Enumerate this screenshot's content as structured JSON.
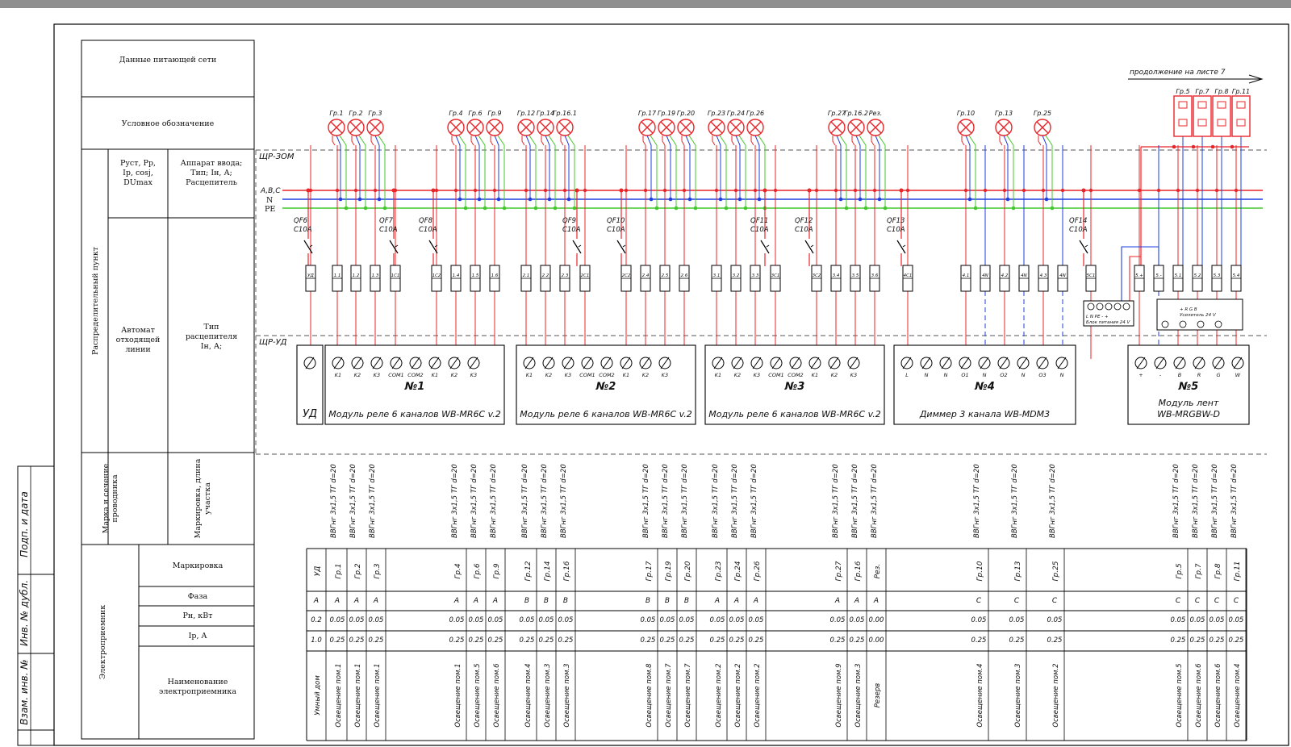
{
  "continuation": "продолжение на листе 7",
  "panels": {
    "main": "ЩР-ЗОМ",
    "ud": "ЩР-УД"
  },
  "bus": {
    "phase": "A,B,C",
    "neutral": "N",
    "pe": "PE"
  },
  "colors": {
    "phase": "#e8262a",
    "neutral": "#1f3fe0",
    "pe": "#42c82a",
    "lamp": "#e8262a",
    "frame": "#000000"
  },
  "header": {
    "network": "Данные питающей сети",
    "symbol": "Условное обозначение",
    "dist_point": "Распределительный пункт",
    "params": [
      "Руст, Рр,",
      "Ip, cosj,",
      "DUmax"
    ],
    "input_device": [
      "Аппарат ввода;",
      "Тип; Iн, А;",
      "Расцепитель"
    ],
    "outgoing": [
      "Автомат",
      "отходящей",
      "линии"
    ],
    "release": [
      "Тип",
      "расцепителя",
      "Iн, А;"
    ],
    "wire": [
      "Марка и сечение",
      "проводника"
    ],
    "wire_mark": [
      "Маркировка, длина",
      "участка"
    ],
    "consumer": "Электроприемник",
    "marking": "Маркировка",
    "phase": "Фаза",
    "power": "Рн, кВт",
    "current": "Ip, A",
    "name": [
      "Наименование",
      "электроприемника"
    ]
  },
  "stamps": [
    "Подп. и дата",
    "Инв. № дубл.",
    "Взам. инв. №"
  ],
  "lamp_groups": [
    {
      "labels": [
        "Гр.1",
        "Гр.2",
        "Гр.3"
      ]
    },
    {
      "labels": [
        "Гр.4",
        "Гр.6",
        "Гр.9"
      ]
    },
    {
      "labels": [
        "Гр.12",
        "Гр.14",
        "Гр.16.1"
      ]
    },
    {
      "labels": [
        "Гр.17",
        "Гр.19",
        "Гр.20"
      ]
    },
    {
      "labels": [
        "Гр.23",
        "Гр.24",
        "Гр.26"
      ]
    },
    {
      "labels": [
        "Гр.27",
        "Гр.16.2",
        "Рез."
      ]
    },
    {
      "labels": [
        "Гр.10"
      ]
    },
    {
      "labels": [
        "Гр.13"
      ]
    },
    {
      "labels": [
        "Гр.25"
      ]
    }
  ],
  "rgb_groups": [
    "Гр.5",
    "Гр.7",
    "Гр.8",
    "Гр.11"
  ],
  "breakers": [
    {
      "id": "QF6",
      "rating": "C10A"
    },
    {
      "id": "QF7",
      "rating": "C10A"
    },
    {
      "id": "QF8",
      "rating": "C10A"
    },
    {
      "id": "QF9",
      "rating": "C10A"
    },
    {
      "id": "QF10",
      "rating": "C10A"
    },
    {
      "id": "QF11",
      "rating": "C10A"
    },
    {
      "id": "QF12",
      "rating": "C10A"
    },
    {
      "id": "QF13",
      "rating": "C10A"
    },
    {
      "id": "QF14",
      "rating": "C10A"
    }
  ],
  "terminals": [
    "УД",
    "1.1",
    "1.2",
    "1.3",
    "1С1",
    "1С2",
    "1.4",
    "1.5",
    "1.6",
    "2.1",
    "2.2",
    "2.3",
    "2С1",
    "2С2",
    "2.4",
    "2.5",
    "2.6",
    "3.1",
    "3.2",
    "3.3",
    "3С1",
    "3С2",
    "3.4",
    "3.5",
    "3.6",
    "4С1",
    "4.1",
    "4N",
    "4.2",
    "4N",
    "4.3",
    "4N",
    "5С1",
    "5.+",
    "5.-",
    "5.1",
    "5.2",
    "5.3",
    "5.4"
  ],
  "modules": [
    {
      "num": "",
      "name": "УД"
    },
    {
      "num": "№1",
      "name": "Модуль реле 6 каналов WB-MR6C v.2",
      "terms": [
        "K1",
        "K2",
        "K3",
        "COM1",
        "COM2",
        "K1",
        "K2",
        "K3"
      ]
    },
    {
      "num": "№2",
      "name": "Модуль реле 6 каналов WB-MR6C v.2",
      "terms": [
        "K1",
        "K2",
        "K3",
        "COM1",
        "COM2",
        "K1",
        "K2",
        "K3"
      ]
    },
    {
      "num": "№3",
      "name": "Модуль реле 6 каналов WB-MR6C v.2",
      "terms": [
        "K1",
        "K2",
        "K3",
        "COM1",
        "COM2",
        "K1",
        "K2",
        "K3"
      ]
    },
    {
      "num": "№4",
      "name": "Диммер 3 канала WB-MDM3",
      "terms": [
        "L",
        "N",
        "N",
        "O1",
        "N",
        "O2",
        "N",
        "O3",
        "N"
      ]
    },
    {
      "num": "№5",
      "name": "Модуль лент",
      "name2": "WB-MRGBW-D",
      "terms": [
        "+",
        "-",
        "B",
        "R",
        "G",
        "W"
      ]
    }
  ],
  "psu": {
    "label": "L  N  PE  -  +",
    "sub": "Блок питания 24 V"
  },
  "amp": {
    "label": "+ R  G  B",
    "sub": "Усилитель 24 V"
  },
  "cable_label": "ВВГнг 3х1,5 ТГ d=20",
  "table": {
    "rows": [
      {
        "mark": "УД",
        "phase": "A",
        "power": "0.2",
        "current": "1.0",
        "name": "Умный дом"
      },
      {
        "mark": "Гр.1",
        "phase": "A",
        "power": "0.05",
        "current": "0.25",
        "name": "Освещение пом.1"
      },
      {
        "mark": "Гр.2",
        "phase": "A",
        "power": "0.05",
        "current": "0.25",
        "name": "Освещение пом.1"
      },
      {
        "mark": "Гр.3",
        "phase": "A",
        "power": "0.05",
        "current": "0.25",
        "name": "Освещение пом.1"
      },
      {
        "mark": "Гр.4",
        "phase": "A",
        "power": "0.05",
        "current": "0.25",
        "name": "Освещение пом.1"
      },
      {
        "mark": "Гр.6",
        "phase": "A",
        "power": "0.05",
        "current": "0.25",
        "name": "Освещение пом.5"
      },
      {
        "mark": "Гр.9",
        "phase": "A",
        "power": "0.05",
        "current": "0.25",
        "name": "Освещение пом.6"
      },
      {
        "mark": "Гр.12",
        "phase": "B",
        "power": "0.05",
        "current": "0.25",
        "name": "Освещение пом.4"
      },
      {
        "mark": "Гр.14",
        "phase": "B",
        "power": "0.05",
        "current": "0.25",
        "name": "Освещение пом.3"
      },
      {
        "mark": "Гр.16",
        "phase": "B",
        "power": "0.05",
        "current": "0.25",
        "name": "Освещение пом.3"
      },
      {
        "mark": "Гр.17",
        "phase": "B",
        "power": "0.05",
        "current": "0.25",
        "name": "Освещение пом.8"
      },
      {
        "mark": "Гр.19",
        "phase": "B",
        "power": "0.05",
        "current": "0.25",
        "name": "Освещение пом.7"
      },
      {
        "mark": "Гр.20",
        "phase": "B",
        "power": "0.05",
        "current": "0.25",
        "name": "Освещение пом.7"
      },
      {
        "mark": "Гр.23",
        "phase": "A",
        "power": "0.05",
        "current": "0.25",
        "name": "Освещение пом.2"
      },
      {
        "mark": "Гр.24",
        "phase": "A",
        "power": "0.05",
        "current": "0.25",
        "name": "Освещение пом.2"
      },
      {
        "mark": "Гр.26",
        "phase": "A",
        "power": "0.05",
        "current": "0.25",
        "name": "Освещение пом.2"
      },
      {
        "mark": "Гр.27",
        "phase": "A",
        "power": "0.05",
        "current": "0.25",
        "name": "Освещение пом.9"
      },
      {
        "mark": "Гр.16",
        "phase": "A",
        "power": "0.05",
        "current": "0.25",
        "name": "Освещение пом.3"
      },
      {
        "mark": "Рез.",
        "phase": "A",
        "power": "0.00",
        "current": "0.00",
        "name": "Резерв"
      },
      {
        "mark": "Гр.10",
        "phase": "C",
        "power": "0.05",
        "current": "0.25",
        "name": "Освещение пом.4"
      },
      {
        "mark": "Гр.13",
        "phase": "C",
        "power": "0.05",
        "current": "0.25",
        "name": "Освещение пом.3"
      },
      {
        "mark": "Гр.25",
        "phase": "C",
        "power": "0.05",
        "current": "0.25",
        "name": "Освещение пом.2"
      },
      {
        "mark": "Гр.5",
        "phase": "C",
        "power": "0.05",
        "current": "0.25",
        "name": "Освещение пом.5"
      },
      {
        "mark": "Гр.7",
        "phase": "C",
        "power": "0.05",
        "current": "0.25",
        "name": "Освещение пом.6"
      },
      {
        "mark": "Гр.8",
        "phase": "C",
        "power": "0.05",
        "current": "0.25",
        "name": "Освещение пом.6"
      },
      {
        "mark": "Гр.11",
        "phase": "C",
        "power": "0.05",
        "current": "0.25",
        "name": "Освещение пом.4"
      }
    ]
  }
}
